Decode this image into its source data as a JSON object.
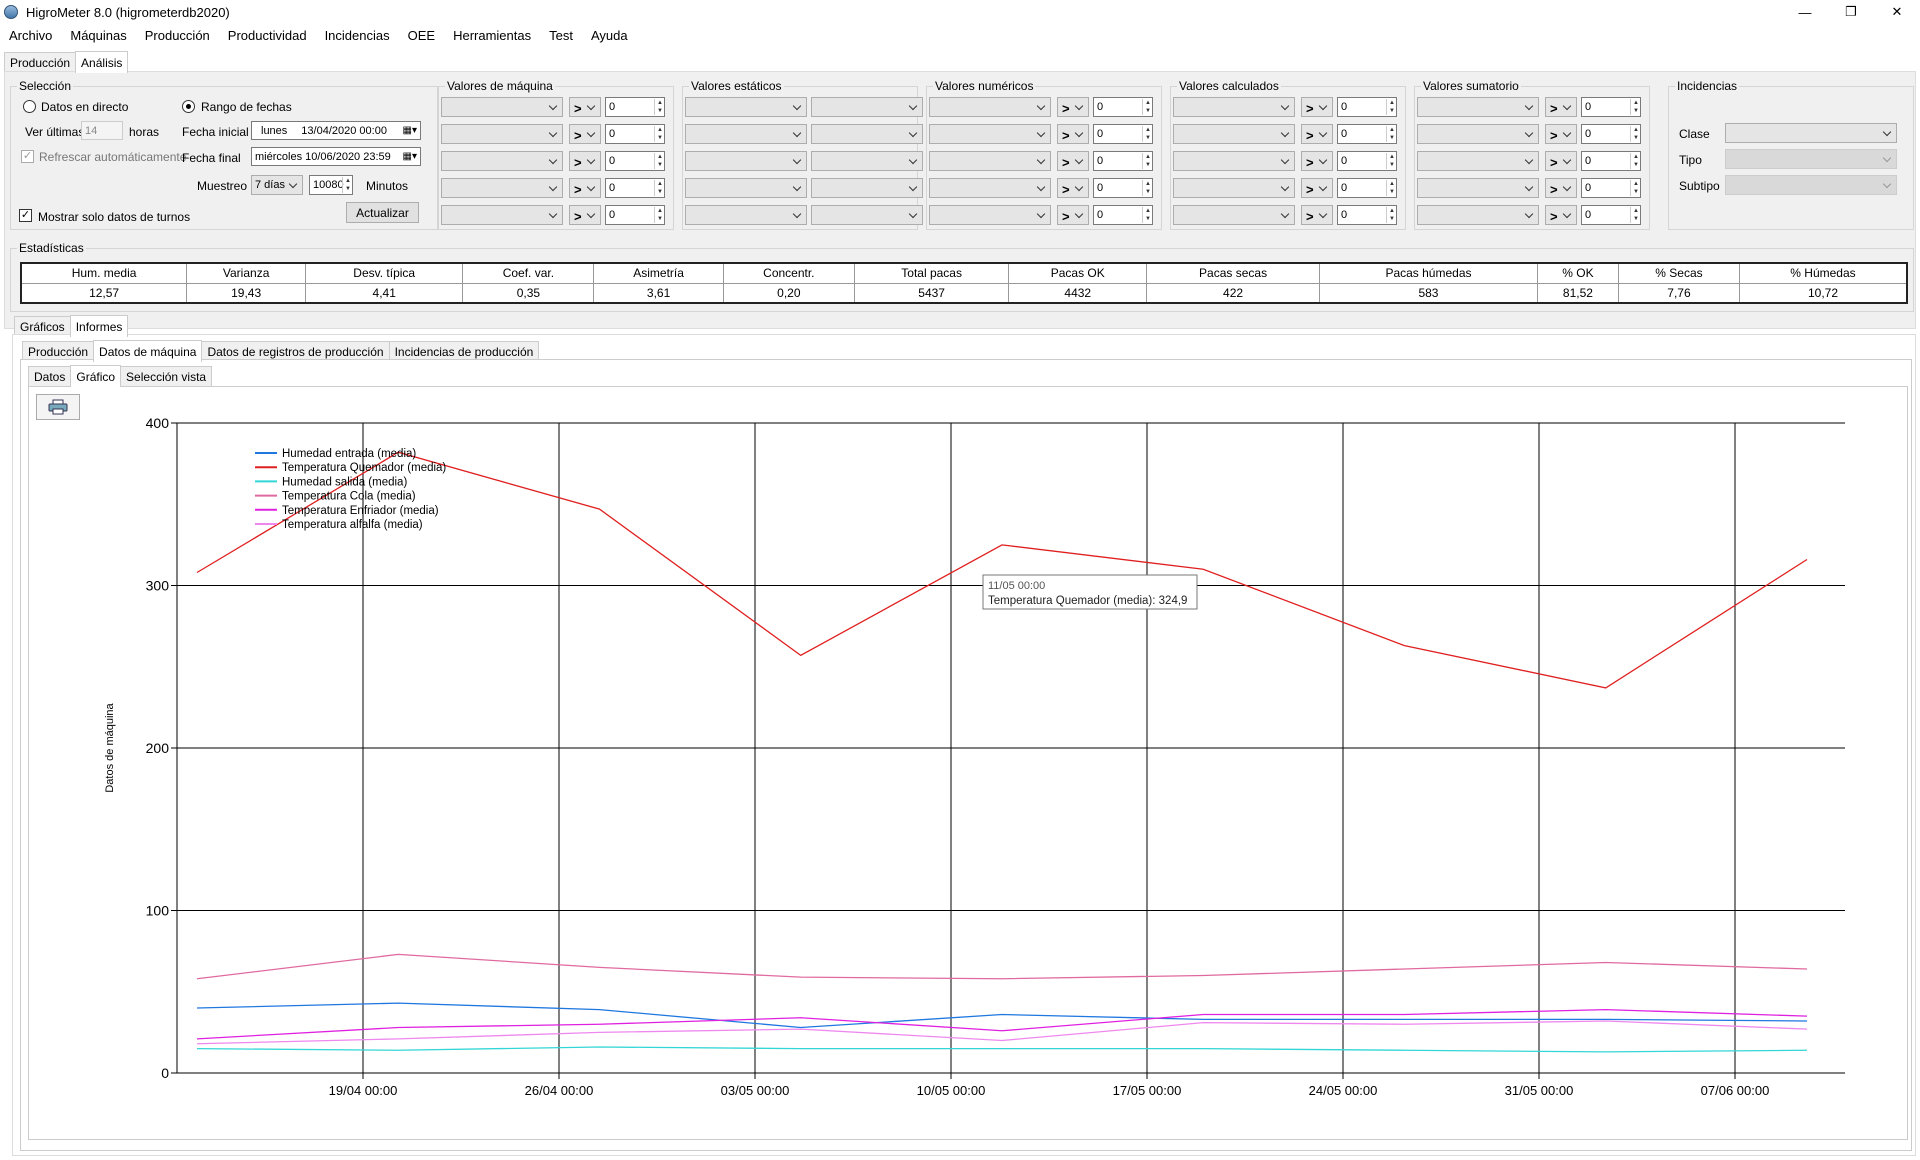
{
  "window": {
    "title": "HigroMeter 8.0 (higrometerdb2020)"
  },
  "menu": [
    "Archivo",
    "Máquinas",
    "Producción",
    "Productividad",
    "Incidencias",
    "OEE",
    "Herramientas",
    "Test",
    "Ayuda"
  ],
  "main_tabs": [
    "Producción",
    "Análisis"
  ],
  "seleccion": {
    "title": "Selección",
    "datos_directo": "Datos en directo",
    "rango_fechas": "Rango de fechas",
    "ver_ultimas": "Ver últimas",
    "ver_ultimas_value": "14",
    "horas": "horas",
    "refrescar": "Refrescar automáticamente",
    "fecha_inicial_label": "Fecha inicial",
    "fecha_inicial_day": "lunes",
    "fecha_inicial_value": "13/04/2020 00:00",
    "fecha_final_label": "Fecha final",
    "fecha_final_value": "miércoles 10/06/2020 23:59",
    "muestreo_label": "Muestreo",
    "muestreo_value": "7 días",
    "muestreo_minutes": "10080",
    "minutos": "Minutos",
    "mostrar_turnos": "Mostrar solo datos de turnos",
    "actualizar": "Actualizar"
  },
  "filter_groups": [
    {
      "title": "Valores de máquina",
      "op": ">",
      "value": "0"
    },
    {
      "title": "Valores estáticos"
    },
    {
      "title": "Valores numéricos",
      "op": ">",
      "value": "0"
    },
    {
      "title": "Valores calculados",
      "op": ">",
      "value": "0"
    },
    {
      "title": "Valores sumatorio",
      "op": ">",
      "value": "0"
    }
  ],
  "incidencias": {
    "title": "Incidencias",
    "clase": "Clase",
    "tipo": "Tipo",
    "subtipo": "Subtipo"
  },
  "estadisticas": {
    "title": "Estadísticas",
    "headers": [
      "Hum. media",
      "Varianza",
      "Desv. típica",
      "Coef. var.",
      "Asimetría",
      "Concentr.",
      "Total pacas",
      "Pacas OK",
      "Pacas secas",
      "Pacas húmedas",
      "% OK",
      "% Secas",
      "% Húmedas"
    ],
    "values": [
      "12,57",
      "19,43",
      "4,41",
      "0,35",
      "3,61",
      "0,20",
      "5437",
      "4432",
      "422",
      "583",
      "81,52",
      "7,76",
      "10,72"
    ]
  },
  "sub_tabs": [
    "Gráficos",
    "Informes"
  ],
  "report_tabs": [
    "Producción",
    "Datos de máquina",
    "Datos de registros de producción",
    "Incidencias de producción"
  ],
  "view_tabs": [
    "Datos",
    "Gráfico",
    "Selección vista"
  ],
  "tooltip": {
    "line1": "11/05 00:00",
    "line2": "Temperatura Quemador (media): 324,9"
  },
  "chart_data": {
    "type": "line",
    "ylabel": "Datos de máquina",
    "ylim": [
      0,
      400
    ],
    "yticks": [
      0,
      100,
      200,
      300,
      400
    ],
    "xticks": [
      "19/04 00:00",
      "26/04 00:00",
      "03/05 00:00",
      "10/05 00:00",
      "17/05 00:00",
      "24/05 00:00",
      "31/05 00:00",
      "07/06 00:00"
    ],
    "x": [
      "13/04",
      "20/04",
      "27/04",
      "04/05",
      "11/05",
      "18/05",
      "25/05",
      "01/06",
      "08/06"
    ],
    "legend_position": "top-left",
    "series": [
      {
        "name": "Humedad entrada (media)",
        "color": "#1f77e0",
        "values": [
          40,
          43,
          39,
          28,
          36,
          33,
          33,
          33,
          32
        ]
      },
      {
        "name": "Temperatura Quemador (media)",
        "color": "#e02020",
        "values": [
          308,
          382,
          347,
          257,
          325,
          310,
          263,
          237,
          316
        ]
      },
      {
        "name": "Humedad salida (media)",
        "color": "#33d6d6",
        "values": [
          15,
          14,
          16,
          15,
          15,
          15,
          14,
          13,
          14
        ]
      },
      {
        "name": "Temperatura Cola (media)",
        "color": "#e06aa0",
        "values": [
          58,
          73,
          65,
          59,
          58,
          60,
          64,
          68,
          64
        ]
      },
      {
        "name": "Temperatura Enfriador (media)",
        "color": "#e020e0",
        "values": [
          21,
          28,
          30,
          34,
          26,
          36,
          36,
          39,
          35
        ]
      },
      {
        "name": "Temperatura alfalfa (media)",
        "color": "#ee88ee",
        "values": [
          18,
          21,
          25,
          27,
          20,
          31,
          30,
          32,
          27
        ]
      }
    ]
  }
}
